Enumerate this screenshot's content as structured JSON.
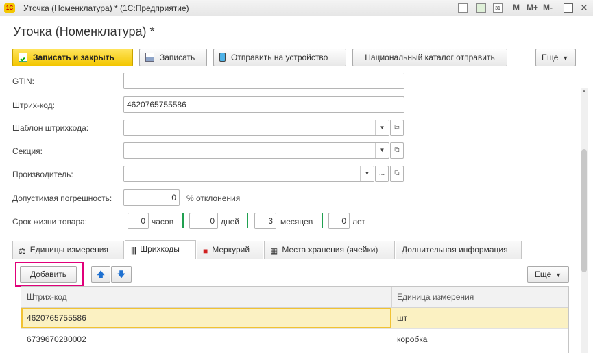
{
  "window": {
    "logo": "1C",
    "title": "Уточка (Номенклатура) * (1С:Предприятие)",
    "toolbar_m": "M",
    "toolbar_mplus": "M+",
    "toolbar_mminus": "M-",
    "close_glyph": "✕",
    "calendar_day": "31"
  },
  "form": {
    "title": "Уточка (Номенклатура) *"
  },
  "toolbar": {
    "save_close": "Записать и закрыть",
    "save": "Записать",
    "send_device": "Отправить на устройство",
    "national_catalog": "Национальный каталог отправить",
    "more": "Еще"
  },
  "fields": {
    "gtin_label": "GTIN:",
    "gtin_value": "",
    "barcode_label": "Штрих-код:",
    "barcode_value": "4620765755586",
    "barcode_template_label": "Шаблон штрихкода:",
    "barcode_template_value": "",
    "section_label": "Секция:",
    "section_value": "",
    "manufacturer_label": "Производитель:",
    "manufacturer_value": "",
    "tolerance_label": "Допустимая погрешность:",
    "tolerance_value": "0",
    "tolerance_unit": "% отклонения",
    "shelf_life_label": "Срок жизни товара:",
    "hours_value": "0",
    "hours_unit": "часов",
    "days_value": "0",
    "days_unit": "дней",
    "months_value": "3",
    "months_unit": "месяцев",
    "years_value": "0",
    "years_unit": "лет"
  },
  "tabs": [
    {
      "label": "Единицы измерения"
    },
    {
      "label": "Шрихкоды"
    },
    {
      "label": "Меркурий"
    },
    {
      "label": "Места хранения (ячейки)"
    },
    {
      "label": "Долнительная информация"
    }
  ],
  "table_toolbar": {
    "add": "Добавить",
    "more": "Еще"
  },
  "table": {
    "columns": [
      "Штрих-код",
      "Единица измерения"
    ],
    "rows": [
      [
        "4620765755586",
        "шт"
      ],
      [
        "6739670280002",
        "коробка"
      ]
    ]
  },
  "colors": {
    "primary_button": "#f3c600",
    "highlight": "#e0007a",
    "selected_row": "#fbf1c2"
  }
}
